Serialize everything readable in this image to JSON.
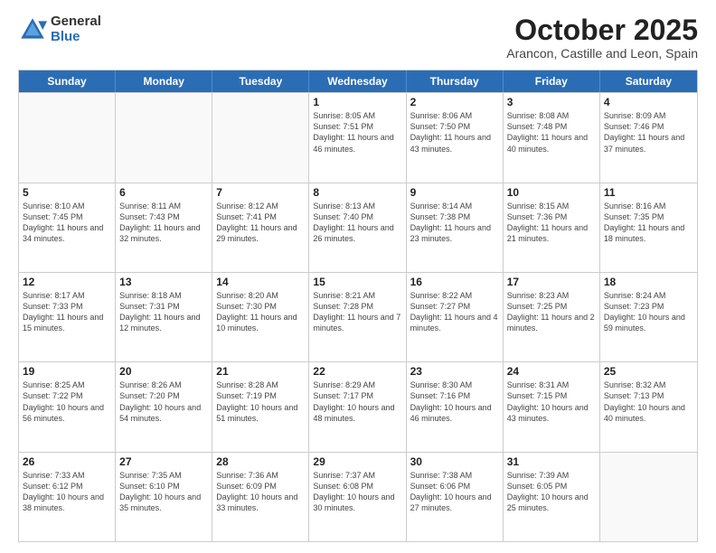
{
  "logo": {
    "general": "General",
    "blue": "Blue"
  },
  "header": {
    "month": "October 2025",
    "location": "Arancon, Castille and Leon, Spain"
  },
  "weekdays": [
    "Sunday",
    "Monday",
    "Tuesday",
    "Wednesday",
    "Thursday",
    "Friday",
    "Saturday"
  ],
  "weeks": [
    [
      {
        "day": "",
        "sunrise": "",
        "sunset": "",
        "daylight": ""
      },
      {
        "day": "",
        "sunrise": "",
        "sunset": "",
        "daylight": ""
      },
      {
        "day": "",
        "sunrise": "",
        "sunset": "",
        "daylight": ""
      },
      {
        "day": "1",
        "sunrise": "Sunrise: 8:05 AM",
        "sunset": "Sunset: 7:51 PM",
        "daylight": "Daylight: 11 hours and 46 minutes."
      },
      {
        "day": "2",
        "sunrise": "Sunrise: 8:06 AM",
        "sunset": "Sunset: 7:50 PM",
        "daylight": "Daylight: 11 hours and 43 minutes."
      },
      {
        "day": "3",
        "sunrise": "Sunrise: 8:08 AM",
        "sunset": "Sunset: 7:48 PM",
        "daylight": "Daylight: 11 hours and 40 minutes."
      },
      {
        "day": "4",
        "sunrise": "Sunrise: 8:09 AM",
        "sunset": "Sunset: 7:46 PM",
        "daylight": "Daylight: 11 hours and 37 minutes."
      }
    ],
    [
      {
        "day": "5",
        "sunrise": "Sunrise: 8:10 AM",
        "sunset": "Sunset: 7:45 PM",
        "daylight": "Daylight: 11 hours and 34 minutes."
      },
      {
        "day": "6",
        "sunrise": "Sunrise: 8:11 AM",
        "sunset": "Sunset: 7:43 PM",
        "daylight": "Daylight: 11 hours and 32 minutes."
      },
      {
        "day": "7",
        "sunrise": "Sunrise: 8:12 AM",
        "sunset": "Sunset: 7:41 PM",
        "daylight": "Daylight: 11 hours and 29 minutes."
      },
      {
        "day": "8",
        "sunrise": "Sunrise: 8:13 AM",
        "sunset": "Sunset: 7:40 PM",
        "daylight": "Daylight: 11 hours and 26 minutes."
      },
      {
        "day": "9",
        "sunrise": "Sunrise: 8:14 AM",
        "sunset": "Sunset: 7:38 PM",
        "daylight": "Daylight: 11 hours and 23 minutes."
      },
      {
        "day": "10",
        "sunrise": "Sunrise: 8:15 AM",
        "sunset": "Sunset: 7:36 PM",
        "daylight": "Daylight: 11 hours and 21 minutes."
      },
      {
        "day": "11",
        "sunrise": "Sunrise: 8:16 AM",
        "sunset": "Sunset: 7:35 PM",
        "daylight": "Daylight: 11 hours and 18 minutes."
      }
    ],
    [
      {
        "day": "12",
        "sunrise": "Sunrise: 8:17 AM",
        "sunset": "Sunset: 7:33 PM",
        "daylight": "Daylight: 11 hours and 15 minutes."
      },
      {
        "day": "13",
        "sunrise": "Sunrise: 8:18 AM",
        "sunset": "Sunset: 7:31 PM",
        "daylight": "Daylight: 11 hours and 12 minutes."
      },
      {
        "day": "14",
        "sunrise": "Sunrise: 8:20 AM",
        "sunset": "Sunset: 7:30 PM",
        "daylight": "Daylight: 11 hours and 10 minutes."
      },
      {
        "day": "15",
        "sunrise": "Sunrise: 8:21 AM",
        "sunset": "Sunset: 7:28 PM",
        "daylight": "Daylight: 11 hours and 7 minutes."
      },
      {
        "day": "16",
        "sunrise": "Sunrise: 8:22 AM",
        "sunset": "Sunset: 7:27 PM",
        "daylight": "Daylight: 11 hours and 4 minutes."
      },
      {
        "day": "17",
        "sunrise": "Sunrise: 8:23 AM",
        "sunset": "Sunset: 7:25 PM",
        "daylight": "Daylight: 11 hours and 2 minutes."
      },
      {
        "day": "18",
        "sunrise": "Sunrise: 8:24 AM",
        "sunset": "Sunset: 7:23 PM",
        "daylight": "Daylight: 10 hours and 59 minutes."
      }
    ],
    [
      {
        "day": "19",
        "sunrise": "Sunrise: 8:25 AM",
        "sunset": "Sunset: 7:22 PM",
        "daylight": "Daylight: 10 hours and 56 minutes."
      },
      {
        "day": "20",
        "sunrise": "Sunrise: 8:26 AM",
        "sunset": "Sunset: 7:20 PM",
        "daylight": "Daylight: 10 hours and 54 minutes."
      },
      {
        "day": "21",
        "sunrise": "Sunrise: 8:28 AM",
        "sunset": "Sunset: 7:19 PM",
        "daylight": "Daylight: 10 hours and 51 minutes."
      },
      {
        "day": "22",
        "sunrise": "Sunrise: 8:29 AM",
        "sunset": "Sunset: 7:17 PM",
        "daylight": "Daylight: 10 hours and 48 minutes."
      },
      {
        "day": "23",
        "sunrise": "Sunrise: 8:30 AM",
        "sunset": "Sunset: 7:16 PM",
        "daylight": "Daylight: 10 hours and 46 minutes."
      },
      {
        "day": "24",
        "sunrise": "Sunrise: 8:31 AM",
        "sunset": "Sunset: 7:15 PM",
        "daylight": "Daylight: 10 hours and 43 minutes."
      },
      {
        "day": "25",
        "sunrise": "Sunrise: 8:32 AM",
        "sunset": "Sunset: 7:13 PM",
        "daylight": "Daylight: 10 hours and 40 minutes."
      }
    ],
    [
      {
        "day": "26",
        "sunrise": "Sunrise: 7:33 AM",
        "sunset": "Sunset: 6:12 PM",
        "daylight": "Daylight: 10 hours and 38 minutes."
      },
      {
        "day": "27",
        "sunrise": "Sunrise: 7:35 AM",
        "sunset": "Sunset: 6:10 PM",
        "daylight": "Daylight: 10 hours and 35 minutes."
      },
      {
        "day": "28",
        "sunrise": "Sunrise: 7:36 AM",
        "sunset": "Sunset: 6:09 PM",
        "daylight": "Daylight: 10 hours and 33 minutes."
      },
      {
        "day": "29",
        "sunrise": "Sunrise: 7:37 AM",
        "sunset": "Sunset: 6:08 PM",
        "daylight": "Daylight: 10 hours and 30 minutes."
      },
      {
        "day": "30",
        "sunrise": "Sunrise: 7:38 AM",
        "sunset": "Sunset: 6:06 PM",
        "daylight": "Daylight: 10 hours and 27 minutes."
      },
      {
        "day": "31",
        "sunrise": "Sunrise: 7:39 AM",
        "sunset": "Sunset: 6:05 PM",
        "daylight": "Daylight: 10 hours and 25 minutes."
      },
      {
        "day": "",
        "sunrise": "",
        "sunset": "",
        "daylight": ""
      }
    ]
  ]
}
